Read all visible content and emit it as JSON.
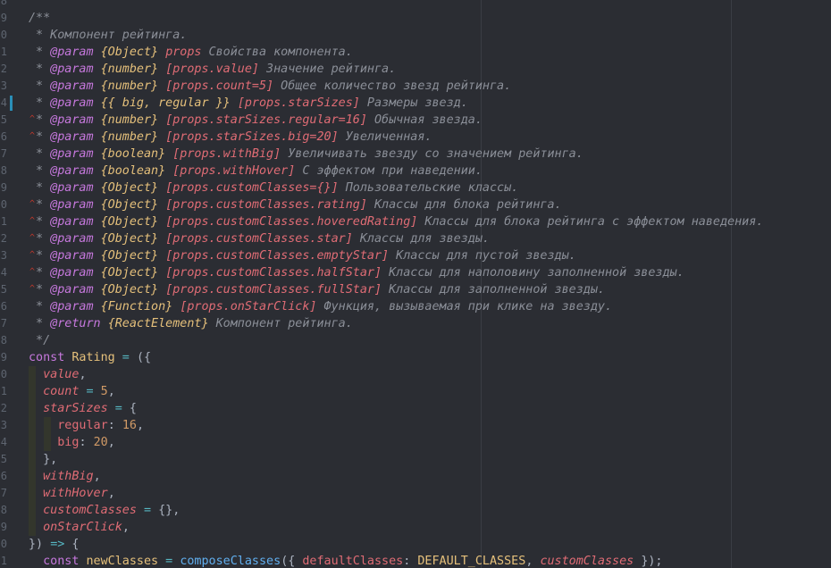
{
  "editor": {
    "line_numbers": [
      "8",
      "9",
      "0",
      "1",
      "2",
      "3",
      "4",
      "5",
      "6",
      "7",
      "8",
      "9",
      "0",
      "1",
      "2",
      "3",
      "4",
      "5",
      "6",
      "7",
      "8",
      "9",
      "0",
      "1",
      "2",
      "3",
      "4",
      "5",
      "6",
      "7",
      "8",
      "9",
      "0",
      "1"
    ],
    "lines": [
      {
        "ln": "8",
        "code": ""
      },
      {
        "ln": "9",
        "code": "/**"
      },
      {
        "ln": "0",
        "code": " * Компонент рейтинга."
      },
      {
        "ln": "1",
        "code": " * @param {Object} props Свойства компонента."
      },
      {
        "ln": "2",
        "code": " * @param {number} [props.value] Значение рейтинга."
      },
      {
        "ln": "3",
        "code": " * @param {number} [props.count=5] Общее количество звезд рейтинга."
      },
      {
        "ln": "4",
        "code": " * @param {{ big, regular }} [props.starSizes] Размеры звезд."
      },
      {
        "ln": "5",
        "code": " * @param {number} [props.starSizes.regular=16] Обычная звезда."
      },
      {
        "ln": "6",
        "code": " * @param {number} [props.starSizes.big=20] Увеличенная."
      },
      {
        "ln": "7",
        "code": " * @param {boolean} [props.withBig] Увеличивать звезду со значением рейтинга."
      },
      {
        "ln": "8",
        "code": " * @param {boolean} [props.withHover] С эффектом при наведении."
      },
      {
        "ln": "9",
        "code": " * @param {Object} [props.customClasses={}] Пользовательские классы."
      },
      {
        "ln": "0",
        "code": " * @param {Object} [props.customClasses.rating] Классы для блока рейтинга."
      },
      {
        "ln": "1",
        "code": " * @param {Object} [props.customClasses.hoveredRating] Классы для блока рейтинга с эффектом наведения."
      },
      {
        "ln": "2",
        "code": " * @param {Object} [props.customClasses.star] Классы для звезды."
      },
      {
        "ln": "3",
        "code": " * @param {Object} [props.customClasses.emptyStar] Классы для пустой звезды."
      },
      {
        "ln": "4",
        "code": " * @param {Object} [props.customClasses.halfStar] Классы для наполовину заполненной звезды."
      },
      {
        "ln": "5",
        "code": " * @param {Object} [props.customClasses.fullStar] Классы для заполненной звезды."
      },
      {
        "ln": "6",
        "code": " * @param {Function} [props.onStarClick] Функция, вызываемая при клике на звезду."
      },
      {
        "ln": "7",
        "code": " * @return {ReactElement} Компонент рейтинга."
      },
      {
        "ln": "8",
        "code": " */"
      },
      {
        "ln": "9",
        "code": "const Rating = ({"
      },
      {
        "ln": "0",
        "code": "  value,"
      },
      {
        "ln": "1",
        "code": "  count = 5,"
      },
      {
        "ln": "2",
        "code": "  starSizes = {"
      },
      {
        "ln": "3",
        "code": "    regular: 16,"
      },
      {
        "ln": "4",
        "code": "    big: 20,"
      },
      {
        "ln": "5",
        "code": "  },"
      },
      {
        "ln": "6",
        "code": "  withBig,"
      },
      {
        "ln": "7",
        "code": "  withHover,"
      },
      {
        "ln": "8",
        "code": "  customClasses = {},"
      },
      {
        "ln": "9",
        "code": "  onStarClick,"
      },
      {
        "ln": "0",
        "code": "}) => {"
      },
      {
        "ln": "1",
        "code": "  const newClasses = composeClasses({ defaultClasses: DEFAULT_CLASSES, customClasses });"
      }
    ]
  },
  "colors": {
    "background": "#2b2d33",
    "comment": "#8b8f98",
    "jsdoc_tag": "#c678dd",
    "jsdoc_type": "#e5c07b",
    "jsdoc_param": "#e06c75",
    "keyword": "#c678dd",
    "number": "#d19a66",
    "function": "#61afef",
    "change_marker": "#2a8fb8"
  }
}
